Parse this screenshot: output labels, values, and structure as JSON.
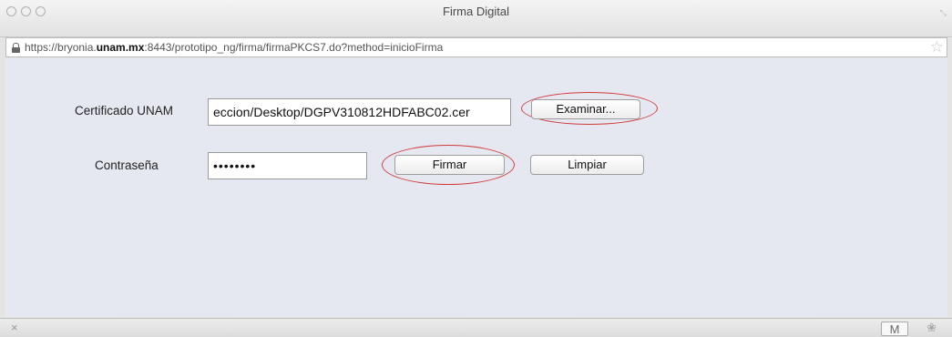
{
  "window": {
    "title": "Firma Digital"
  },
  "address_bar": {
    "url_prefix": "https://bryonia.",
    "url_domain": "unam.mx",
    "url_suffix": ":8443/prototipo_ng/firma/firmaPKCS7.do?method=inicioFirma"
  },
  "form": {
    "certificate_label": "Certificado UNAM",
    "certificate_value": "eccion/Desktop/DGPV310812HDFABC02.cer",
    "browse_button": "Examinar...",
    "password_label": "Contraseña",
    "password_value": "••••••••",
    "sign_button": "Firmar",
    "clear_button": "Limpiar"
  },
  "status_bar": {
    "close_symbol": "×",
    "mail_symbol": "M"
  },
  "icons": {
    "lock": "lock-icon",
    "star": "bookmark-star-icon",
    "puzzle": "puzzle-icon"
  },
  "colors": {
    "highlight_ring": "#d23a3a",
    "content_bg": "#e6e8f1"
  }
}
